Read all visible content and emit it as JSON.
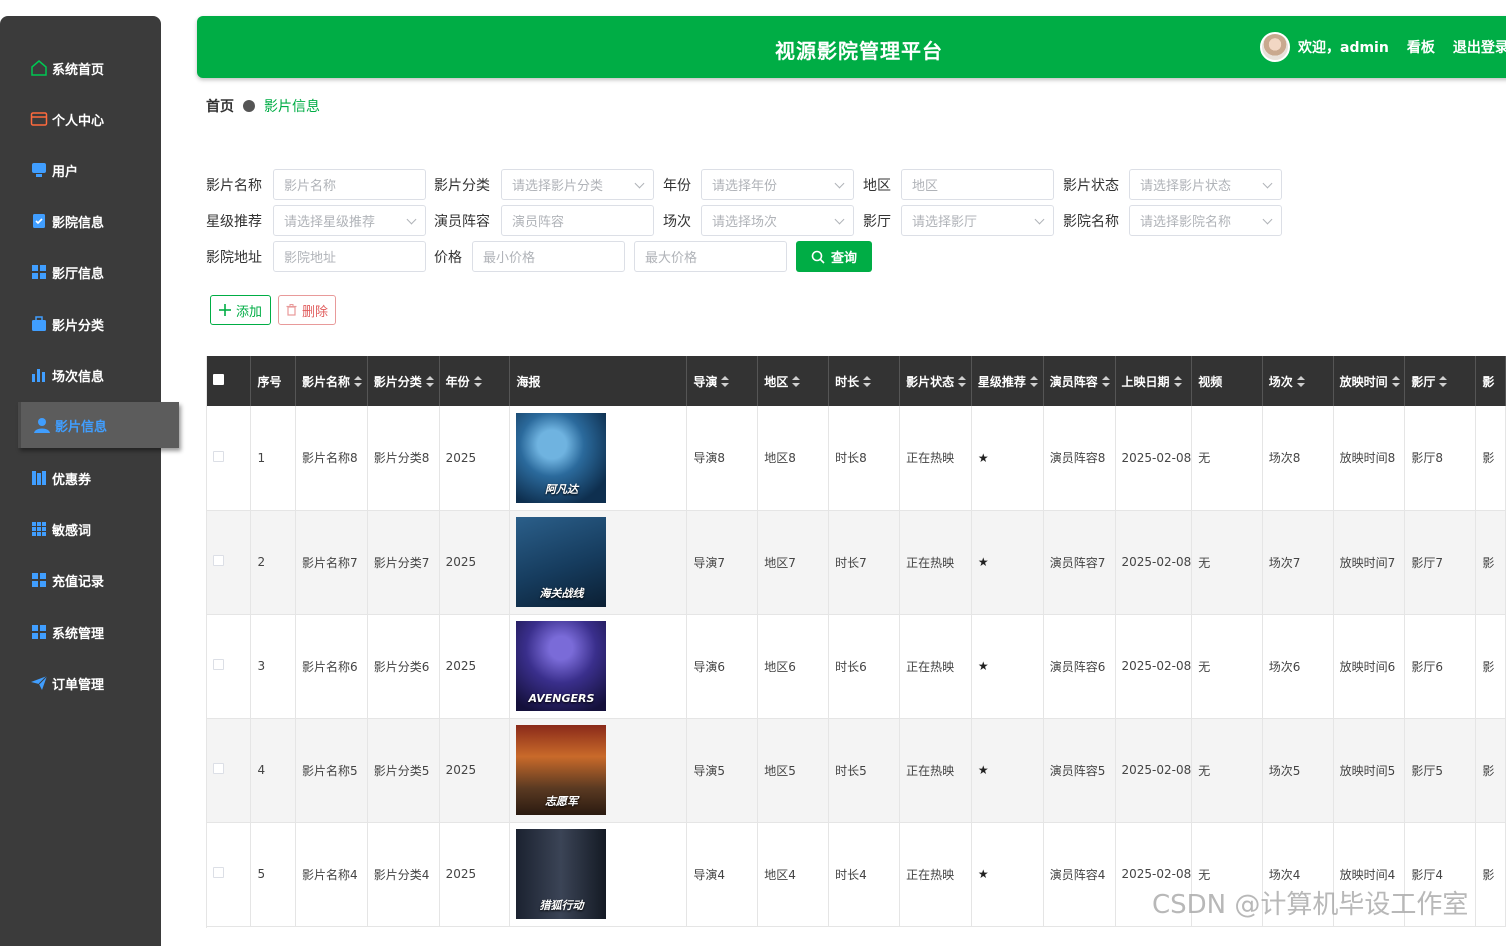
{
  "sidebar": {
    "items": [
      {
        "label": "系统首页",
        "icon": "home-icon"
      },
      {
        "label": "个人中心",
        "icon": "wallet-icon"
      },
      {
        "label": "用户",
        "icon": "monitor-icon"
      },
      {
        "label": "影院信息",
        "icon": "clipboard-check-icon"
      },
      {
        "label": "影厅信息",
        "icon": "grid-icon"
      },
      {
        "label": "影片分类",
        "icon": "briefcase-icon"
      },
      {
        "label": "场次信息",
        "icon": "bar-chart-icon"
      },
      {
        "label": "影片信息",
        "icon": "user-icon"
      },
      {
        "label": "优惠券",
        "icon": "books-icon"
      },
      {
        "label": "敏感词",
        "icon": "apps-icon"
      },
      {
        "label": "充值记录",
        "icon": "grid-icon"
      },
      {
        "label": "系统管理",
        "icon": "grid-icon"
      },
      {
        "label": "订单管理",
        "icon": "paper-plane-icon"
      }
    ],
    "active_index": 7,
    "accent": "#409eff"
  },
  "header": {
    "title": "视源影院管理平台",
    "welcome": "欢迎，admin",
    "board": "看板",
    "logout": "退出登录",
    "color": "#00ad45"
  },
  "breadcrumb": {
    "home": "首页",
    "current": "影片信息"
  },
  "search": {
    "film_name": {
      "label": "影片名称",
      "placeholder": "影片名称"
    },
    "category": {
      "label": "影片分类",
      "placeholder": "请选择影片分类"
    },
    "year": {
      "label": "年份",
      "placeholder": "请选择年份"
    },
    "region": {
      "label": "地区",
      "placeholder": "地区"
    },
    "status": {
      "label": "影片状态",
      "placeholder": "请选择影片状态"
    },
    "rating": {
      "label": "星级推荐",
      "placeholder": "请选择星级推荐"
    },
    "cast": {
      "label": "演员阵容",
      "placeholder": "演员阵容"
    },
    "session": {
      "label": "场次",
      "placeholder": "请选择场次"
    },
    "hall": {
      "label": "影厅",
      "placeholder": "请选择影厅"
    },
    "cinema_name": {
      "label": "影院名称",
      "placeholder": "请选择影院名称"
    },
    "cinema_addr": {
      "label": "影院地址",
      "placeholder": "影院地址"
    },
    "price": {
      "label": "价格",
      "min_placeholder": "最小价格",
      "max_placeholder": "最大价格"
    },
    "query_label": "查询"
  },
  "actions": {
    "add_label": "添加",
    "delete_label": "删除"
  },
  "table": {
    "columns": [
      "序号",
      "影片名称",
      "影片分类",
      "年份",
      "海报",
      "导演",
      "地区",
      "时长",
      "影片状态",
      "星级推荐",
      "演员阵容",
      "上映日期",
      "视频",
      "场次",
      "放映时间",
      "影厅",
      "影"
    ],
    "rows": [
      {
        "no": "1",
        "name": "影片名称8",
        "category": "影片分类8",
        "year": "2025",
        "poster_text": "阿凡达",
        "director": "导演8",
        "region": "地区8",
        "duration": "时长8",
        "status": "正在热映",
        "rating": "★",
        "cast": "演员阵容8",
        "release": "2025-02-08",
        "video": "无",
        "session": "场次8",
        "showtime": "放映时间8",
        "hall": "影厅8",
        "extra": "影"
      },
      {
        "no": "2",
        "name": "影片名称7",
        "category": "影片分类7",
        "year": "2025",
        "poster_text": "海关战线",
        "director": "导演7",
        "region": "地区7",
        "duration": "时长7",
        "status": "正在热映",
        "rating": "★",
        "cast": "演员阵容7",
        "release": "2025-02-08",
        "video": "无",
        "session": "场次7",
        "showtime": "放映时间7",
        "hall": "影厅7",
        "extra": "影"
      },
      {
        "no": "3",
        "name": "影片名称6",
        "category": "影片分类6",
        "year": "2025",
        "poster_text": "AVENGERS",
        "director": "导演6",
        "region": "地区6",
        "duration": "时长6",
        "status": "正在热映",
        "rating": "★",
        "cast": "演员阵容6",
        "release": "2025-02-08",
        "video": "无",
        "session": "场次6",
        "showtime": "放映时间6",
        "hall": "影厅6",
        "extra": "影"
      },
      {
        "no": "4",
        "name": "影片名称5",
        "category": "影片分类5",
        "year": "2025",
        "poster_text": "志愿军",
        "director": "导演5",
        "region": "地区5",
        "duration": "时长5",
        "status": "正在热映",
        "rating": "★",
        "cast": "演员阵容5",
        "release": "2025-02-08",
        "video": "无",
        "session": "场次5",
        "showtime": "放映时间5",
        "hall": "影厅5",
        "extra": "影"
      },
      {
        "no": "5",
        "name": "影片名称4",
        "category": "影片分类4",
        "year": "2025",
        "poster_text": "猎狐行动",
        "director": "导演4",
        "region": "地区4",
        "duration": "时长4",
        "status": "正在热映",
        "rating": "★",
        "cast": "演员阵容4",
        "release": "2025-02-08",
        "video": "无",
        "session": "场次4",
        "showtime": "放映时间4",
        "hall": "影厅4",
        "extra": "影"
      }
    ]
  },
  "watermark": "CSDN @计算机毕设工作室"
}
